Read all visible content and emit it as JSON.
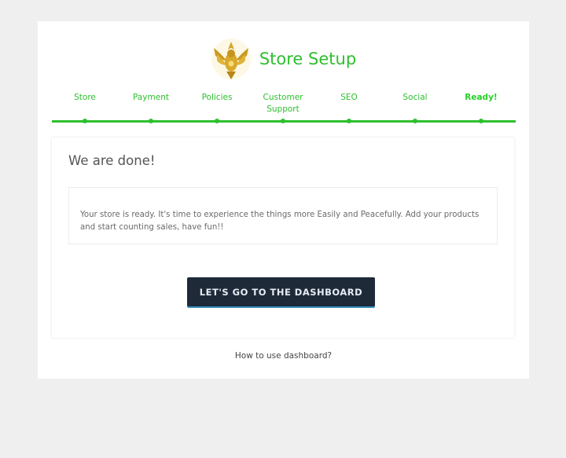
{
  "header": {
    "title": "Store Setup",
    "logo_icon": "phoenix-emblem-icon"
  },
  "steps": [
    {
      "label": "Store",
      "active": false
    },
    {
      "label": "Payment",
      "active": false
    },
    {
      "label": "Policies",
      "active": false
    },
    {
      "label": "Customer\nSupport",
      "active": false
    },
    {
      "label": "SEO",
      "active": false
    },
    {
      "label": "Social",
      "active": false
    },
    {
      "label": "Ready!",
      "active": true
    }
  ],
  "panel": {
    "heading": "We are done!",
    "message": "Your store is ready. It's time to experience the things more Easily and Peacefully. Add your products and start counting sales, have fun!!",
    "button_label": "LET'S GO TO THE DASHBOARD"
  },
  "footer": {
    "help_link": "How to use dashboard?"
  },
  "colors": {
    "accent": "#2ebf2e",
    "button_bg": "#1e2a38",
    "background": "#efefef"
  }
}
